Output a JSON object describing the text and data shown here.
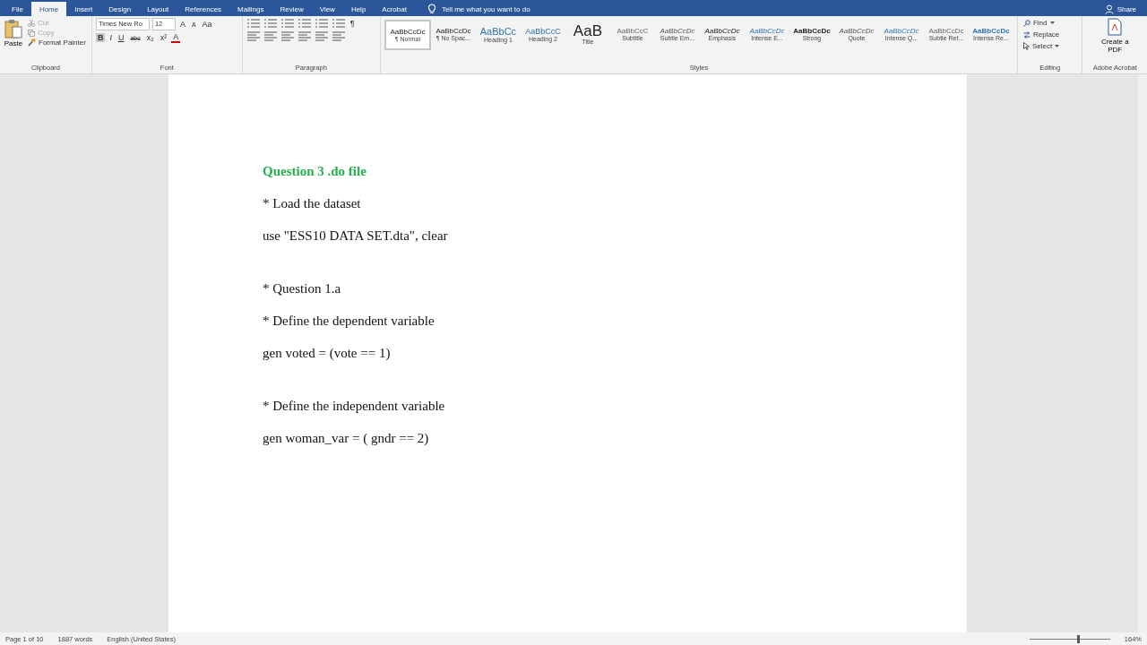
{
  "tabs": [
    {
      "label": "File",
      "selected": false
    },
    {
      "label": "Home",
      "selected": true
    },
    {
      "label": "Insert",
      "selected": false
    },
    {
      "label": "Design",
      "selected": false
    },
    {
      "label": "Layout",
      "selected": false
    },
    {
      "label": "References",
      "selected": false
    },
    {
      "label": "Mailings",
      "selected": false
    },
    {
      "label": "Review",
      "selected": false
    },
    {
      "label": "View",
      "selected": false
    },
    {
      "label": "Help",
      "selected": false
    },
    {
      "label": "Acrobat",
      "selected": false
    }
  ],
  "tell_me": {
    "placeholder": "Tell me what you want to do"
  },
  "share": "Share",
  "clipboard": {
    "paste": "Paste",
    "cut": "Cut",
    "copy": "Copy",
    "format_painter": "Format Painter",
    "label": "Clipboard"
  },
  "font": {
    "name": "Times New Ro",
    "size": "12",
    "grow": "A",
    "shrink": "A",
    "case": "Aa",
    "bold": "B",
    "italic": "I",
    "underline": "U",
    "strike": "abc",
    "subscript": "x₂",
    "superscript": "x²",
    "color_letter": "A",
    "label": "Font"
  },
  "paragraph": {
    "label": "Paragraph",
    "pilcrow": "¶"
  },
  "styles": {
    "label": "Styles",
    "items": [
      {
        "sample": "AaBbCcDc",
        "name": "¶ Normal",
        "kind": "normal",
        "selected": true
      },
      {
        "sample": "AaBbCcDc",
        "name": "¶ No Spac...",
        "kind": "normal",
        "selected": false
      },
      {
        "sample": "AaBbCc",
        "name": "Heading 1",
        "kind": "heading1",
        "selected": false
      },
      {
        "sample": "AaBbCcC",
        "name": "Heading 2",
        "kind": "heading2",
        "selected": false
      },
      {
        "sample": "AaB",
        "name": "Title",
        "kind": "title",
        "selected": false
      },
      {
        "sample": "AaBbCcC",
        "name": "Subtitle",
        "kind": "subtitle",
        "selected": false
      },
      {
        "sample": "AaBbCcDc",
        "name": "Subtle Em...",
        "kind": "subtle",
        "selected": false
      },
      {
        "sample": "AaBbCcDc",
        "name": "Emphasis",
        "kind": "emphasis",
        "selected": false
      },
      {
        "sample": "AaBbCcDc",
        "name": "Intense E...",
        "kind": "intense",
        "selected": false
      },
      {
        "sample": "AaBbCcDc",
        "name": "Strong",
        "kind": "strong",
        "selected": false
      },
      {
        "sample": "AaBbCcDc",
        "name": "Quote",
        "kind": "subtle",
        "selected": false
      },
      {
        "sample": "AaBbCcDc",
        "name": "Intense Q...",
        "kind": "intense",
        "selected": false
      },
      {
        "sample": "AaBbCcDc",
        "name": "Subtle Ref...",
        "kind": "subtitle",
        "selected": false
      },
      {
        "sample": "AaBbCcDc",
        "name": "Intense Re...",
        "kind": "intenseref",
        "selected": false
      }
    ]
  },
  "editing": {
    "find": "Find",
    "replace": "Replace",
    "select": "Select",
    "label": "Editing"
  },
  "acrobat": {
    "create": "Create a PDF",
    "label": "Adobe Acrobat"
  },
  "document": [
    {
      "lines": [
        {
          "text": "Question 3 .do file",
          "kind": "heading"
        },
        {
          "text": "* Load the dataset",
          "kind": "body"
        },
        {
          "text": "use \"ESS10 DATA SET.dta\", clear",
          "kind": "body"
        }
      ]
    },
    {
      "lines": [
        {
          "text": "* Question 1.a",
          "kind": "body"
        },
        {
          "text": "* Define the dependent variable",
          "kind": "body"
        },
        {
          "text": "gen voted = (vote == 1)",
          "kind": "body"
        }
      ]
    },
    {
      "lines": [
        {
          "text": "* Define the independent variable",
          "kind": "body"
        },
        {
          "text": "gen woman_var = ( gndr == 2)",
          "kind": "body"
        }
      ]
    }
  ],
  "status_bar": {
    "page": "Page 1 of 10",
    "words": "1887 words",
    "language": "English (United States)",
    "zoom": "164%",
    "zoom_slider": {
      "level": 0.6
    }
  }
}
